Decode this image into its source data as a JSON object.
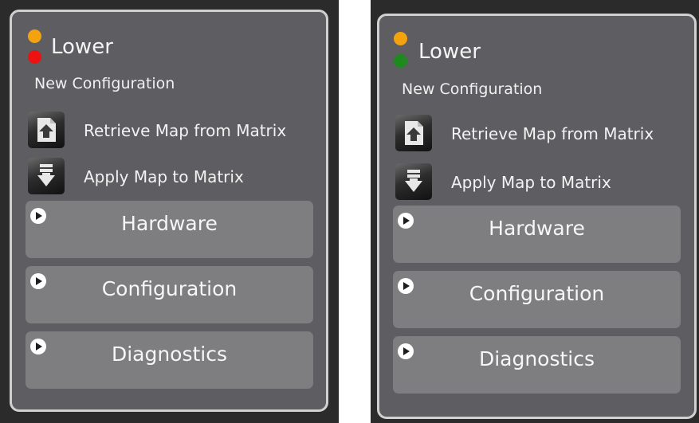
{
  "panels": [
    {
      "status_top_color": "#f5a20f",
      "status_bottom_color": "#ee1111",
      "title": "Lower",
      "subtitle": "New Configuration",
      "actions": [
        {
          "label": "Retrieve Map from Matrix",
          "icon": "retrieve-map-icon"
        },
        {
          "label": "Apply Map to Matrix",
          "icon": "apply-map-icon"
        }
      ],
      "sections": [
        {
          "label": "Hardware"
        },
        {
          "label": "Configuration"
        },
        {
          "label": "Diagnostics"
        }
      ]
    },
    {
      "status_top_color": "#f5a20f",
      "status_bottom_color": "#1e8a1e",
      "title": "Lower",
      "subtitle": "New Configuration",
      "actions": [
        {
          "label": "Retrieve Map from Matrix",
          "icon": "retrieve-map-icon"
        },
        {
          "label": "Apply Map to Matrix",
          "icon": "apply-map-icon"
        }
      ],
      "sections": [
        {
          "label": "Hardware"
        },
        {
          "label": "Configuration"
        },
        {
          "label": "Diagnostics"
        }
      ]
    }
  ]
}
